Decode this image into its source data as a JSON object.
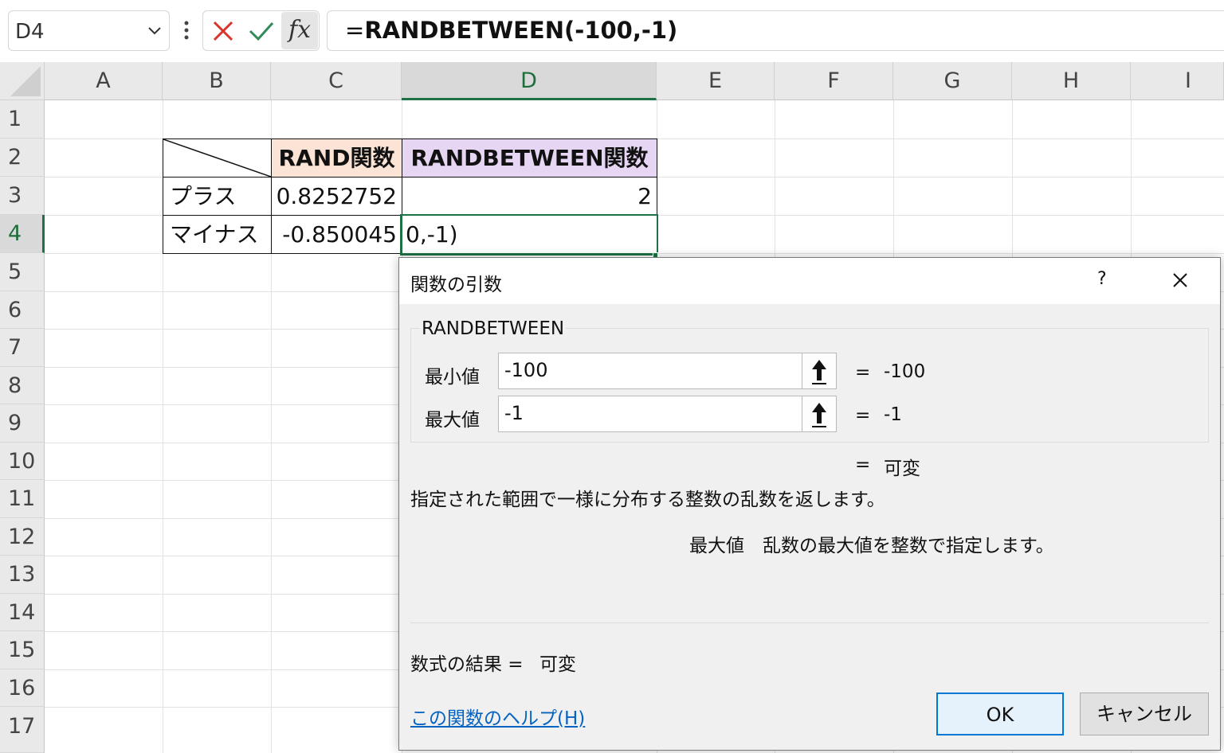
{
  "formula_bar": {
    "name_box": "D4",
    "formula_prefix": "=",
    "formula_body": "RANDBETWEEN(-100,-1)",
    "fx_label": "fx"
  },
  "columns": [
    "A",
    "B",
    "C",
    "D",
    "E",
    "F",
    "G",
    "H",
    "I"
  ],
  "selected_column": "D",
  "rows": [
    "1",
    "2",
    "3",
    "4",
    "5",
    "6",
    "7",
    "8",
    "9",
    "10",
    "11",
    "12",
    "13",
    "14",
    "15",
    "16",
    "17"
  ],
  "selected_row": "4",
  "table": {
    "header_rand": "RAND関数",
    "header_randbetween": "RANDBETWEEN関数",
    "row_plus_label": "プラス",
    "row_plus_rand": "0.8252752",
    "row_plus_randbetween": "2",
    "row_minus_label": "マイナス",
    "row_minus_rand": "-0.850045",
    "row_minus_randbetween_editing": "0,-1)"
  },
  "dialog": {
    "title": "関数の引数",
    "help_glyph": "?",
    "function_name": "RANDBETWEEN",
    "args": [
      {
        "label": "最小値",
        "value": "-100",
        "equals": "=",
        "result": "-100"
      },
      {
        "label": "最大値",
        "value": "-1",
        "equals": "=",
        "result": "-1"
      }
    ],
    "overall_equals": "=",
    "overall_result": "可変",
    "description": "指定された範囲で一様に分布する整数の乱数を返します。",
    "arg_help_name": "最大値",
    "arg_help_text": "乱数の最大値を整数で指定します。",
    "formula_result_label": "数式の結果 =",
    "formula_result_value": "可変",
    "help_link": "この関数のヘルプ(H)",
    "ok_label": "OK",
    "cancel_label": "キャンセル"
  },
  "colors": {
    "accent_green": "#1e7145",
    "rand_header_bg": "#fbe3d5",
    "randbetween_header_bg": "#e6d5f3",
    "cancel_x_red": "#d9342b",
    "confirm_check_green": "#2e8b57",
    "link_blue": "#0563c1"
  }
}
